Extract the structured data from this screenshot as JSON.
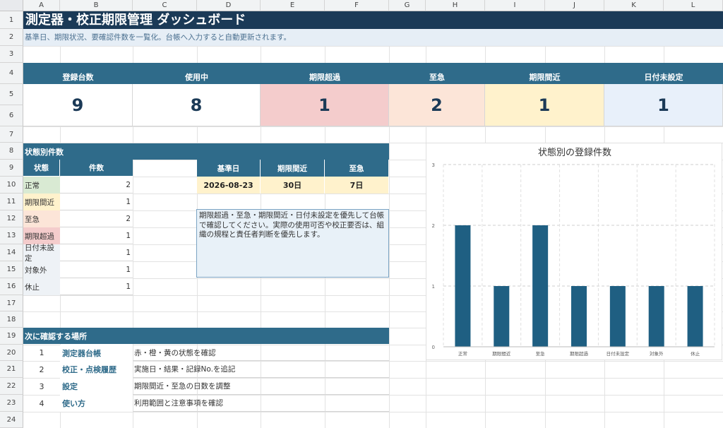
{
  "columns": [
    "A",
    "B",
    "C",
    "D",
    "E",
    "F",
    "G",
    "H",
    "I",
    "J",
    "K",
    "L"
  ],
  "rows": [
    "1",
    "2",
    "3",
    "4",
    "5",
    "6",
    "7",
    "8",
    "9",
    "10",
    "11",
    "12",
    "13",
    "14",
    "15",
    "16",
    "17",
    "18",
    "19",
    "20",
    "21",
    "22",
    "23",
    "24"
  ],
  "title": "測定器・校正期限管理 ダッシュボード",
  "subtitle": "基準日、期限状況、要確認件数を一覧化。台帳へ入力すると自動更新されます。",
  "kpis": [
    {
      "label": "登録台数",
      "value": "9",
      "color": "#ffffff"
    },
    {
      "label": "使用中",
      "value": "8",
      "color": "#ffffff"
    },
    {
      "label": "期限超過",
      "value": "1",
      "color": "#f4cccc"
    },
    {
      "label": "至急",
      "value": "2",
      "color": "#fce5d8"
    },
    {
      "label": "期限間近",
      "value": "1",
      "color": "#fff2cc"
    },
    {
      "label": "日付未設定",
      "value": "1",
      "color": "#e8f0fa"
    }
  ],
  "status_section": {
    "title": "状態別件数",
    "col_status": "状態",
    "col_count": "件数",
    "rows": [
      {
        "label": "正常",
        "count": "2",
        "color": "#d9ead3"
      },
      {
        "label": "期限間近",
        "count": "1",
        "color": "#fff2cc"
      },
      {
        "label": "至急",
        "count": "2",
        "color": "#fce5d8"
      },
      {
        "label": "期限超過",
        "count": "1",
        "color": "#f4cccc"
      },
      {
        "label": "日付未設定",
        "count": "1",
        "color": "#eef2f6"
      },
      {
        "label": "対象外",
        "count": "1",
        "color": "#eef2f6"
      },
      {
        "label": "休止",
        "count": "1",
        "color": "#eef2f6"
      }
    ]
  },
  "reference": {
    "headers": [
      "基準日",
      "期限間近",
      "至急"
    ],
    "values": [
      "2026-08-23",
      "30日",
      "7日"
    ]
  },
  "note": "期限超過・至急・期限間近・日付未設定を優先して台帳で確認してください。実際の使用可否や校正要否は、組織の規程と責任者判断を優先します。",
  "next_section": {
    "title": "次に確認する場所",
    "items": [
      {
        "num": "1",
        "name": "測定器台帳",
        "desc": "赤・橙・黄の状態を確認"
      },
      {
        "num": "2",
        "name": "校正・点検履歴",
        "desc": "実施日・結果・記録No.を追記"
      },
      {
        "num": "3",
        "name": "設定",
        "desc": "期限間近・至急の日数を調整"
      },
      {
        "num": "4",
        "name": "使い方",
        "desc": "利用範囲と注意事項を確認"
      }
    ]
  },
  "chart_data": {
    "type": "bar",
    "title": "状態別の登録件数",
    "categories": [
      "正常",
      "期限間近",
      "至急",
      "期限超過",
      "日付未設定",
      "対象外",
      "休止"
    ],
    "values": [
      2,
      1,
      2,
      1,
      1,
      1,
      1
    ],
    "ylim": [
      0,
      3
    ],
    "yticks": [
      0,
      1,
      2,
      3
    ],
    "bar_color": "#1f5f82",
    "grid": true,
    "legend": "none"
  }
}
